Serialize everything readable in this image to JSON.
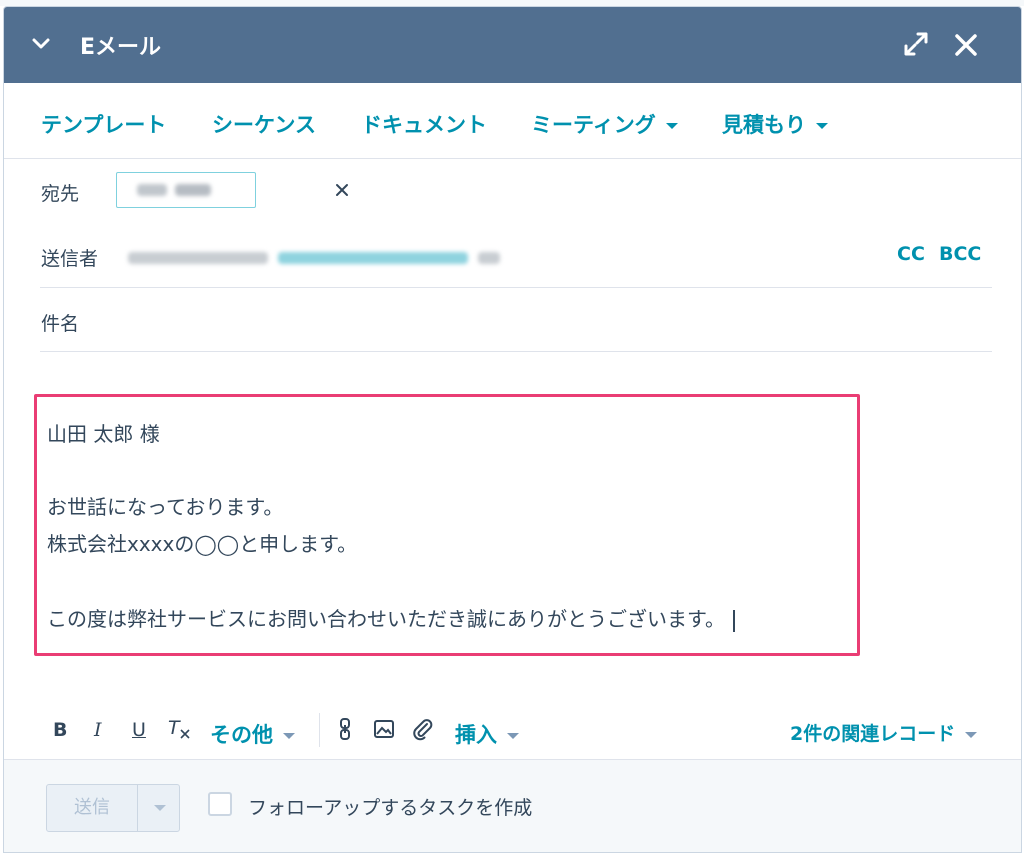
{
  "dialog": {
    "title": "Eメール"
  },
  "toolbar": {
    "template": "テンプレート",
    "sequence": "シーケンス",
    "document": "ドキュメント",
    "meeting": "ミーティング",
    "quote": "見積もり"
  },
  "fields": {
    "to_label": "宛先",
    "from_label": "送信者",
    "cc": "CC",
    "bcc": "BCC",
    "subject_label": "件名",
    "subject_value": ""
  },
  "body": {
    "lines": [
      "山田 太郎 様",
      "",
      "お世話になっております。",
      "株式会社xxxxの◯◯と申します。",
      "",
      "この度は弊社サービスにお問い合わせいただき誠にありがとうございます。"
    ]
  },
  "format_bar": {
    "bold": "B",
    "italic": "I",
    "underline": "U",
    "clear": "T",
    "more": "その他",
    "insert": "挿入",
    "related_records": "2件の関連レコード"
  },
  "footer": {
    "send": "送信",
    "followup_task": "フォローアップするタスクを作成",
    "followup_checked": false
  },
  "colors": {
    "header_bg": "#516f90",
    "link": "#0091ae",
    "highlight_border": "#ea3d74"
  }
}
